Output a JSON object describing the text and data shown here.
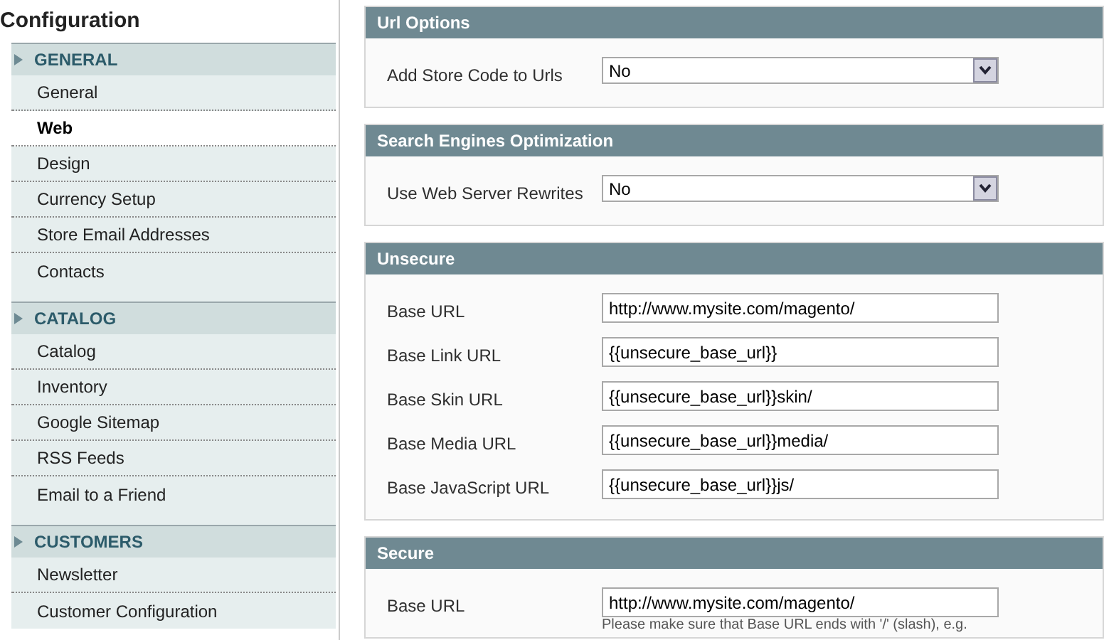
{
  "sidebar": {
    "title": "Configuration",
    "groups": [
      {
        "label": "GENERAL",
        "items": [
          {
            "label": "General",
            "selected": false
          },
          {
            "label": "Web",
            "selected": true
          },
          {
            "label": "Design",
            "selected": false
          },
          {
            "label": "Currency Setup",
            "selected": false
          },
          {
            "label": "Store Email Addresses",
            "selected": false
          },
          {
            "label": "Contacts",
            "selected": false
          }
        ]
      },
      {
        "label": "CATALOG",
        "items": [
          {
            "label": "Catalog",
            "selected": false
          },
          {
            "label": "Inventory",
            "selected": false
          },
          {
            "label": "Google Sitemap",
            "selected": false
          },
          {
            "label": "RSS Feeds",
            "selected": false
          },
          {
            "label": "Email to a Friend",
            "selected": false
          }
        ]
      },
      {
        "label": "CUSTOMERS",
        "items": [
          {
            "label": "Newsletter",
            "selected": false
          },
          {
            "label": "Customer Configuration",
            "selected": false
          }
        ]
      }
    ]
  },
  "sections": [
    {
      "title": "Url Options",
      "fields": [
        {
          "label": "Add Store Code to Urls",
          "kind": "select",
          "value": "No"
        }
      ]
    },
    {
      "title": "Search Engines Optimization",
      "fields": [
        {
          "label": "Use Web Server Rewrites",
          "kind": "select",
          "value": "No"
        }
      ]
    },
    {
      "title": "Unsecure",
      "fields": [
        {
          "label": "Base URL",
          "kind": "text",
          "value": "http://www.mysite.com/magento/"
        },
        {
          "label": "Base Link URL",
          "kind": "text",
          "value": "{{unsecure_base_url}}"
        },
        {
          "label": "Base Skin URL",
          "kind": "text",
          "value": "{{unsecure_base_url}}skin/"
        },
        {
          "label": "Base Media URL",
          "kind": "text",
          "value": "{{unsecure_base_url}}media/"
        },
        {
          "label": "Base JavaScript URL",
          "kind": "text",
          "value": "{{unsecure_base_url}}js/"
        }
      ]
    },
    {
      "title": "Secure",
      "fields": [
        {
          "label": "Base URL",
          "kind": "text",
          "value": "http://www.mysite.com/magento/",
          "note": "Please make sure that Base URL ends with '/' (slash), e.g."
        }
      ]
    }
  ]
}
